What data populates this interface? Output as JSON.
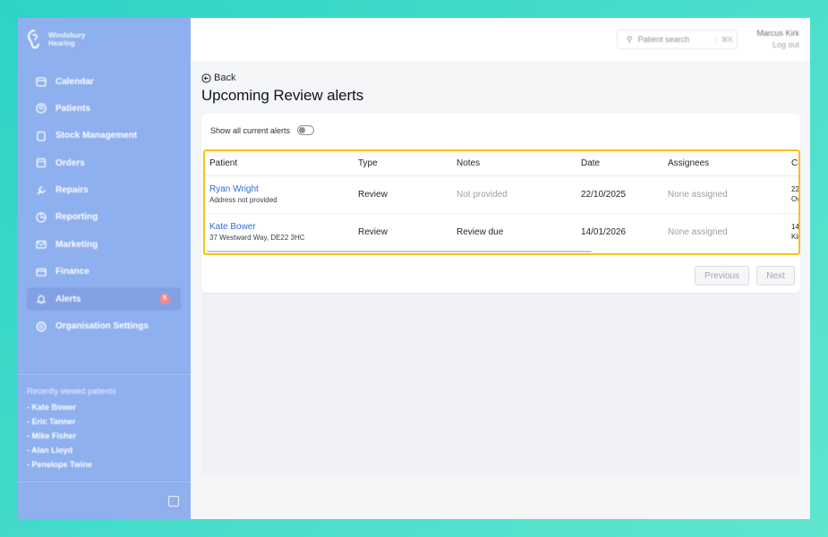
{
  "brand": {
    "line1": "Windsbury",
    "line2": "Hearing"
  },
  "sidebar": {
    "items": [
      {
        "label": "Calendar",
        "icon": "calendar-icon"
      },
      {
        "label": "Patients",
        "icon": "patients-icon"
      },
      {
        "label": "Stock Management",
        "icon": "stock-icon"
      },
      {
        "label": "Orders",
        "icon": "orders-icon"
      },
      {
        "label": "Repairs",
        "icon": "wrench-icon"
      },
      {
        "label": "Reporting",
        "icon": "chart-icon"
      },
      {
        "label": "Marketing",
        "icon": "mail-icon"
      },
      {
        "label": "Finance",
        "icon": "card-icon"
      },
      {
        "label": "Alerts",
        "icon": "bell-icon",
        "badge": "5",
        "active": true
      },
      {
        "label": "Organisation Settings",
        "icon": "gear-icon"
      }
    ],
    "recent_title": "Recently viewed patients",
    "recent": [
      "- Kate Bower",
      "- Eric Tanner",
      "- Mike Fisher",
      "- Alan Lloyd",
      "- Penelope Twine"
    ]
  },
  "topbar": {
    "search_placeholder": "Patient search",
    "search_shortcut": "⌘K",
    "user_name": "Marcus Kirk",
    "logout": "Log out"
  },
  "main": {
    "back_label": "Back",
    "title": "Upcoming Review alerts",
    "toggle_label": "Show all current alerts",
    "toggle_on": false,
    "columns": [
      "Patient",
      "Type",
      "Notes",
      "Date",
      "Assignees",
      "Cr"
    ],
    "rows": [
      {
        "name": "Ryan Wright",
        "address": "Address not provided",
        "type": "Review",
        "notes": "Not provided",
        "notes_muted": true,
        "date": "22/10/2025",
        "assignees": "None assigned",
        "created_1": "22",
        "created_2": "Ov"
      },
      {
        "name": "Kate Bower",
        "address": "37 Westward Way, DE22 3HC",
        "type": "Review",
        "notes": "Review due",
        "notes_muted": false,
        "date": "14/01/2026",
        "assignees": "None assigned",
        "created_1": "14",
        "created_2": "Kir"
      }
    ],
    "pager": {
      "previous": "Previous",
      "next": "Next"
    }
  },
  "colors": {
    "accent": "#2f6fd6",
    "highlight": "#f4c21a",
    "sidebar": "#8fb0ee",
    "badge": "#f08a8a"
  }
}
